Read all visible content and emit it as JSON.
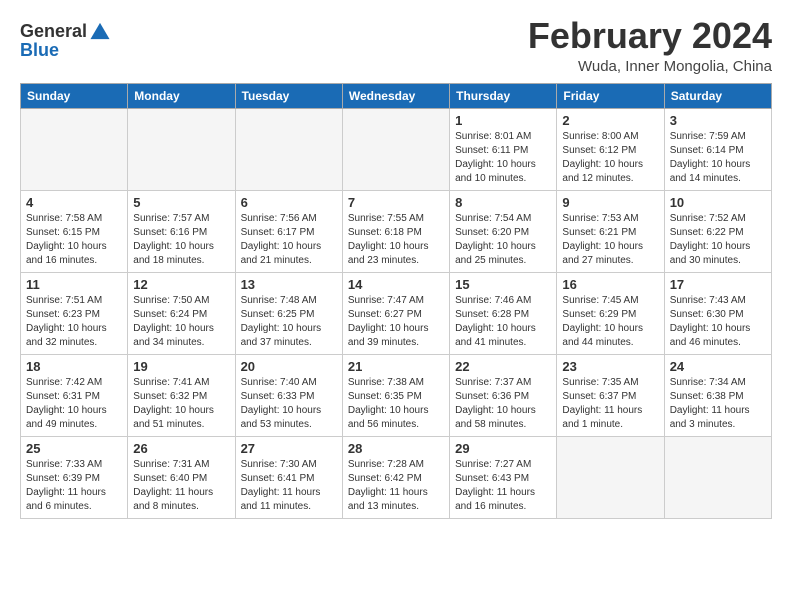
{
  "logo": {
    "line1": "General",
    "line2": "Blue"
  },
  "title": "February 2024",
  "location": "Wuda, Inner Mongolia, China",
  "weekdays": [
    "Sunday",
    "Monday",
    "Tuesday",
    "Wednesday",
    "Thursday",
    "Friday",
    "Saturday"
  ],
  "weeks": [
    [
      {
        "day": "",
        "empty": true
      },
      {
        "day": "",
        "empty": true
      },
      {
        "day": "",
        "empty": true
      },
      {
        "day": "",
        "empty": true
      },
      {
        "day": "1",
        "sunrise": "8:01 AM",
        "sunset": "6:11 PM",
        "daylight": "10 hours and 10 minutes."
      },
      {
        "day": "2",
        "sunrise": "8:00 AM",
        "sunset": "6:12 PM",
        "daylight": "10 hours and 12 minutes."
      },
      {
        "day": "3",
        "sunrise": "7:59 AM",
        "sunset": "6:14 PM",
        "daylight": "10 hours and 14 minutes."
      }
    ],
    [
      {
        "day": "4",
        "sunrise": "7:58 AM",
        "sunset": "6:15 PM",
        "daylight": "10 hours and 16 minutes."
      },
      {
        "day": "5",
        "sunrise": "7:57 AM",
        "sunset": "6:16 PM",
        "daylight": "10 hours and 18 minutes."
      },
      {
        "day": "6",
        "sunrise": "7:56 AM",
        "sunset": "6:17 PM",
        "daylight": "10 hours and 21 minutes."
      },
      {
        "day": "7",
        "sunrise": "7:55 AM",
        "sunset": "6:18 PM",
        "daylight": "10 hours and 23 minutes."
      },
      {
        "day": "8",
        "sunrise": "7:54 AM",
        "sunset": "6:20 PM",
        "daylight": "10 hours and 25 minutes."
      },
      {
        "day": "9",
        "sunrise": "7:53 AM",
        "sunset": "6:21 PM",
        "daylight": "10 hours and 27 minutes."
      },
      {
        "day": "10",
        "sunrise": "7:52 AM",
        "sunset": "6:22 PM",
        "daylight": "10 hours and 30 minutes."
      }
    ],
    [
      {
        "day": "11",
        "sunrise": "7:51 AM",
        "sunset": "6:23 PM",
        "daylight": "10 hours and 32 minutes."
      },
      {
        "day": "12",
        "sunrise": "7:50 AM",
        "sunset": "6:24 PM",
        "daylight": "10 hours and 34 minutes."
      },
      {
        "day": "13",
        "sunrise": "7:48 AM",
        "sunset": "6:25 PM",
        "daylight": "10 hours and 37 minutes."
      },
      {
        "day": "14",
        "sunrise": "7:47 AM",
        "sunset": "6:27 PM",
        "daylight": "10 hours and 39 minutes."
      },
      {
        "day": "15",
        "sunrise": "7:46 AM",
        "sunset": "6:28 PM",
        "daylight": "10 hours and 41 minutes."
      },
      {
        "day": "16",
        "sunrise": "7:45 AM",
        "sunset": "6:29 PM",
        "daylight": "10 hours and 44 minutes."
      },
      {
        "day": "17",
        "sunrise": "7:43 AM",
        "sunset": "6:30 PM",
        "daylight": "10 hours and 46 minutes."
      }
    ],
    [
      {
        "day": "18",
        "sunrise": "7:42 AM",
        "sunset": "6:31 PM",
        "daylight": "10 hours and 49 minutes."
      },
      {
        "day": "19",
        "sunrise": "7:41 AM",
        "sunset": "6:32 PM",
        "daylight": "10 hours and 51 minutes."
      },
      {
        "day": "20",
        "sunrise": "7:40 AM",
        "sunset": "6:33 PM",
        "daylight": "10 hours and 53 minutes."
      },
      {
        "day": "21",
        "sunrise": "7:38 AM",
        "sunset": "6:35 PM",
        "daylight": "10 hours and 56 minutes."
      },
      {
        "day": "22",
        "sunrise": "7:37 AM",
        "sunset": "6:36 PM",
        "daylight": "10 hours and 58 minutes."
      },
      {
        "day": "23",
        "sunrise": "7:35 AM",
        "sunset": "6:37 PM",
        "daylight": "11 hours and 1 minute."
      },
      {
        "day": "24",
        "sunrise": "7:34 AM",
        "sunset": "6:38 PM",
        "daylight": "11 hours and 3 minutes."
      }
    ],
    [
      {
        "day": "25",
        "sunrise": "7:33 AM",
        "sunset": "6:39 PM",
        "daylight": "11 hours and 6 minutes."
      },
      {
        "day": "26",
        "sunrise": "7:31 AM",
        "sunset": "6:40 PM",
        "daylight": "11 hours and 8 minutes."
      },
      {
        "day": "27",
        "sunrise": "7:30 AM",
        "sunset": "6:41 PM",
        "daylight": "11 hours and 11 minutes."
      },
      {
        "day": "28",
        "sunrise": "7:28 AM",
        "sunset": "6:42 PM",
        "daylight": "11 hours and 13 minutes."
      },
      {
        "day": "29",
        "sunrise": "7:27 AM",
        "sunset": "6:43 PM",
        "daylight": "11 hours and 16 minutes."
      },
      {
        "day": "",
        "empty": true
      },
      {
        "day": "",
        "empty": true
      }
    ]
  ]
}
